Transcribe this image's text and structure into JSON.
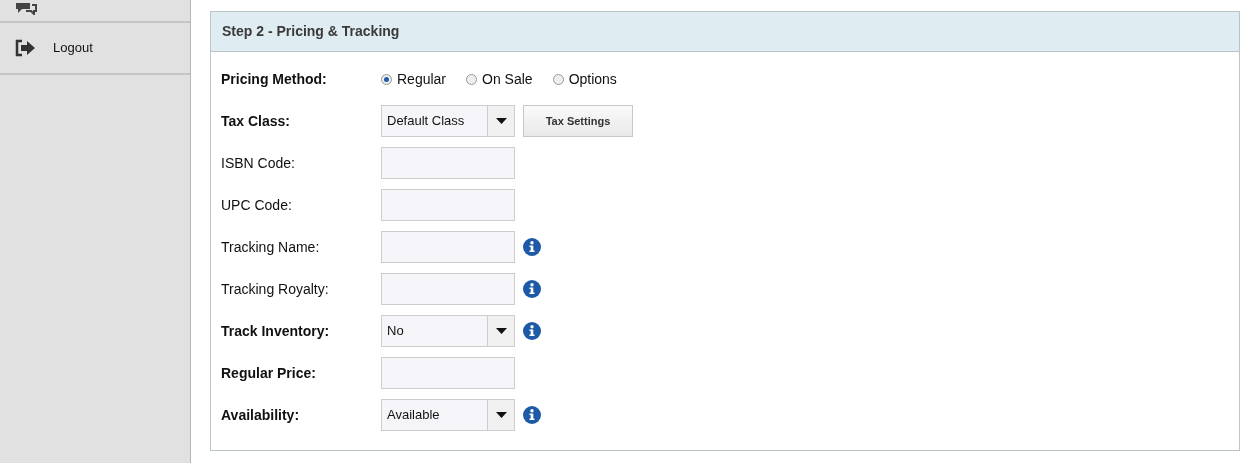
{
  "sidebar": {
    "items": [
      {
        "label": "Logout"
      }
    ]
  },
  "panel": {
    "title": "Step 2 - Pricing & Tracking",
    "fields": [
      {
        "kind": "radio",
        "label": "Pricing Method:",
        "bold": true,
        "options": [
          {
            "label": "Regular",
            "selected": true
          },
          {
            "label": "On Sale",
            "selected": false
          },
          {
            "label": "Options",
            "selected": false
          }
        ]
      },
      {
        "kind": "select",
        "label": "Tax Class:",
        "bold": true,
        "value": "Default Class",
        "button": "Tax Settings",
        "info": false
      },
      {
        "kind": "text",
        "label": "ISBN Code:",
        "bold": false,
        "info": false
      },
      {
        "kind": "text",
        "label": "UPC Code:",
        "bold": false,
        "info": false
      },
      {
        "kind": "text",
        "label": "Tracking Name:",
        "bold": false,
        "info": true
      },
      {
        "kind": "text",
        "label": "Tracking Royalty:",
        "bold": false,
        "info": true
      },
      {
        "kind": "select",
        "label": "Track Inventory:",
        "bold": true,
        "value": "No",
        "info": true
      },
      {
        "kind": "text",
        "label": "Regular Price:",
        "bold": true,
        "info": false
      },
      {
        "kind": "select",
        "label": "Availability:",
        "bold": true,
        "value": "Available",
        "info": true
      }
    ]
  }
}
